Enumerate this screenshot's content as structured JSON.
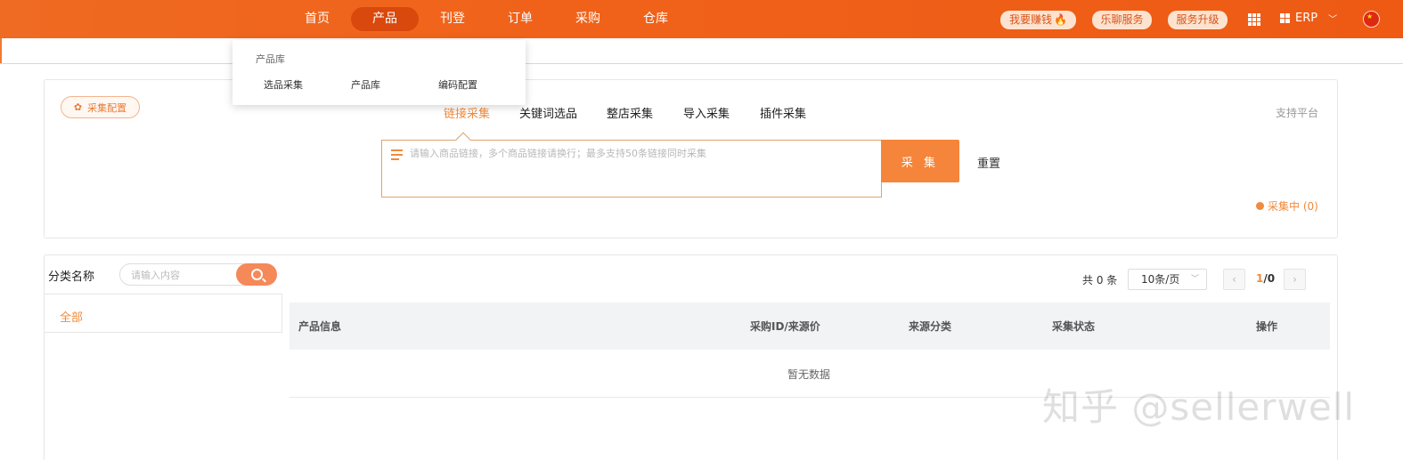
{
  "nav": {
    "items": [
      "首页",
      "产品",
      "刊登",
      "订单",
      "采购",
      "仓库"
    ],
    "active_index": 1
  },
  "header_right": {
    "earn": "我要赚钱",
    "service": "乐聊服务",
    "upgrade": "服务升级",
    "erp": "ERP"
  },
  "dropdown": {
    "title": "产品库",
    "items": [
      "选品采集",
      "产品库",
      "编码配置"
    ]
  },
  "collect": {
    "config_button": "采集配置",
    "tabs": [
      "链接采集",
      "关键词选品",
      "整店采集",
      "导入采集",
      "插件采集"
    ],
    "active_tab": 0,
    "support_platform": "支持平台",
    "input_placeholder": "请输入商品链接，多个商品链接请换行；最多支持50条链接同时采集",
    "collect_button": "采 集",
    "reset_button": "重置",
    "status_text": "采集中 (0)"
  },
  "category": {
    "label": "分类名称",
    "search_placeholder": "请输入内容",
    "items": [
      "全部"
    ]
  },
  "pagination": {
    "total": "共 0 条",
    "page_size": "10条/页",
    "current": "1",
    "sep_total": "/0"
  },
  "table": {
    "columns": [
      "产品信息",
      "采购ID/来源价",
      "来源分类",
      "采集状态",
      "操作"
    ],
    "empty_text": "暂无数据"
  },
  "watermark": "知乎 @sellerwell",
  "colors": {
    "brand": "#ef6a22",
    "accent": "#f08a3c"
  }
}
